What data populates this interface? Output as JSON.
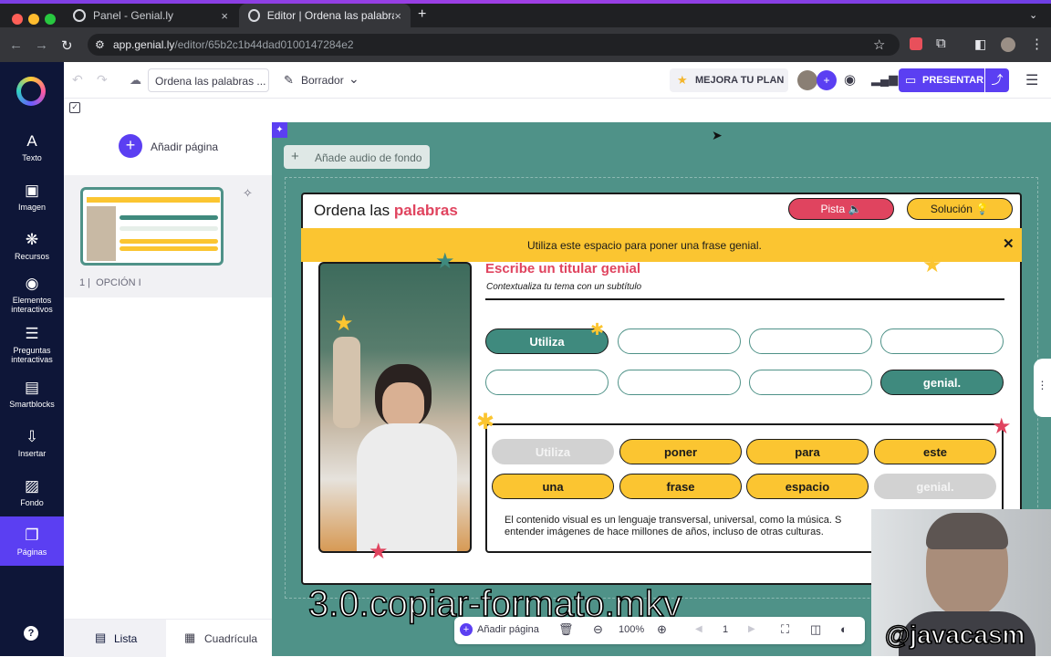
{
  "browser": {
    "tabs": [
      {
        "label": "Panel - Genial.ly",
        "close": "×"
      },
      {
        "label": "Editor | Ordena las palabras e",
        "close": "×"
      }
    ],
    "new_tab": "+",
    "url_domain": "app.genial.ly",
    "url_path": "/editor/65b2c1b44dad0100147284e2"
  },
  "toolbar": {
    "title_field": "Ordena las palabras ...",
    "status": "Borrador",
    "upgrade": "MEJORA TU PLAN",
    "present": "PRESENTAR"
  },
  "sidebar": {
    "items": [
      {
        "icon": "A",
        "label": "Texto"
      },
      {
        "icon": "▣",
        "label": "Imagen"
      },
      {
        "icon": "❋",
        "label": "Recursos"
      },
      {
        "icon": "◉",
        "label": "Elementos interactivos"
      },
      {
        "icon": "☰",
        "label": "Preguntas interactivas"
      },
      {
        "icon": "▤",
        "label": "Smartblocks"
      },
      {
        "icon": "⇩",
        "label": "Insertar"
      },
      {
        "icon": "▨",
        "label": "Fondo"
      },
      {
        "icon": "❐",
        "label": "Páginas"
      }
    ],
    "help": "?"
  },
  "pages_panel": {
    "add_page": "Añadir página",
    "page_number": "1",
    "page_name": "OPCIÓN I",
    "view_list": "Lista",
    "view_grid": "Cuadrícula"
  },
  "canvas": {
    "add_audio": "Añade audio de fondo"
  },
  "slide": {
    "title_plain": "Ordena las",
    "title_accent": "palabras",
    "hint_button": "Pista 🔈",
    "solution_button": "Solución 💡",
    "banner": "Utiliza este espacio para poner una frase genial.",
    "banner_close": "✕",
    "headline": "Escribe un titular genial",
    "subtitle": "Contextualiza tu tema con un subtítulo",
    "slots_row1": [
      "Utiliza",
      "",
      "",
      ""
    ],
    "slots_row2": [
      "",
      "",
      "",
      "genial."
    ],
    "words_row1": [
      "Utiliza",
      "poner",
      "para",
      "este"
    ],
    "words_row2": [
      "una",
      "frase",
      "espacio",
      "genial."
    ],
    "body_text_line1": "El contenido visual es un lenguaje transversal, universal, como la música. S",
    "body_text_line2": "entender imágenes de hace millones de años, incluso de otras culturas."
  },
  "bottom_bar": {
    "add_page": "Añadir página",
    "zoom": "100%",
    "page": "1"
  },
  "overlay": {
    "caption": "3.0.copiar-formato.mkv",
    "handle": "@javacasm"
  },
  "colors": {
    "accent_purple": "#5b3ff2",
    "canvas_teal": "#4f9288",
    "banner_yellow": "#fbc531",
    "title_pink": "#e0445f",
    "sidebar_navy": "#0e1638"
  }
}
